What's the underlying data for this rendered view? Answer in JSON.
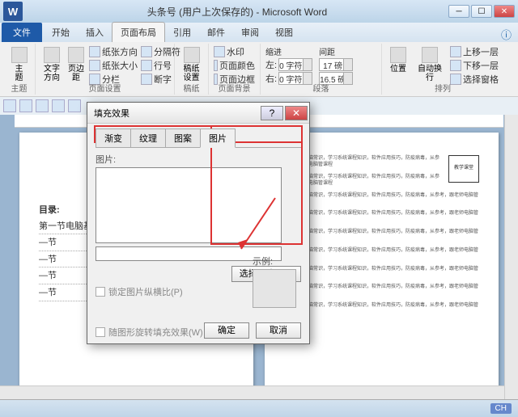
{
  "app": {
    "title": "头条号 (用户上次保存的) - Microsoft Word",
    "word_glyph": "W"
  },
  "win": {
    "min": "─",
    "max": "☐",
    "close": "✕"
  },
  "menu": {
    "file": "文件",
    "items": [
      "开始",
      "插入",
      "页面布局",
      "引用",
      "邮件",
      "审阅",
      "视图"
    ],
    "active_index": 2,
    "help": "ⓘ"
  },
  "ribbon": {
    "groups": {
      "theme": {
        "label": "主题",
        "item": "主题"
      },
      "page_setup": {
        "label": "页面设置",
        "big1": "文字方向",
        "big2": "页边距",
        "row1": "纸张方向",
        "row2": "纸张大小",
        "row3": "分栏",
        "row1b": "分隔符",
        "row2b": "行号",
        "row3b": "断字"
      },
      "manuscript": {
        "label": "稿纸",
        "item": "稿纸设置"
      },
      "page_bg": {
        "label": "页面背景",
        "row1": "水印",
        "row2": "页面颜色",
        "row3": "页面边框"
      },
      "paragraph": {
        "label": "段落",
        "indent_label": "缩进",
        "spacing_label": "间距",
        "left_label": "左:",
        "right_label": "右:",
        "before_label": "",
        "after_label": "",
        "left_val": "0 字符",
        "right_val": "0 字符",
        "before_val": "17 磅",
        "after_val": "16.5 磅"
      },
      "arrange": {
        "label": "排列",
        "big1": "位置",
        "big2": "自动换行",
        "row1": "上移一层",
        "row2": "下移一层",
        "row3": "选择窗格"
      }
    }
  },
  "dialog": {
    "title": "填充效果",
    "tabs": [
      "渐变",
      "纹理",
      "图案",
      "图片"
    ],
    "active_tab": 3,
    "section_label": "图片:",
    "select_btn": "选择图片(L)...",
    "lock_ratio": "锁定图片纵横比(P)",
    "rotate_fill": "随图形旋转填充效果(W)",
    "sample_label": "示例:",
    "ok": "确定",
    "cancel": "取消",
    "help": "?",
    "close": "✕"
  },
  "doc": {
    "toc_title": "目录:",
    "toc_items": [
      "第一节电脑基础",
      "—节",
      "—节",
      "—节",
      "—节"
    ],
    "body_text": "多层讲解电脑常识，学习系统课程知识，软件应用技巧，防疫病毒，从参考，跟老师电脑管课程"
  },
  "status": {
    "lang": "CH"
  }
}
